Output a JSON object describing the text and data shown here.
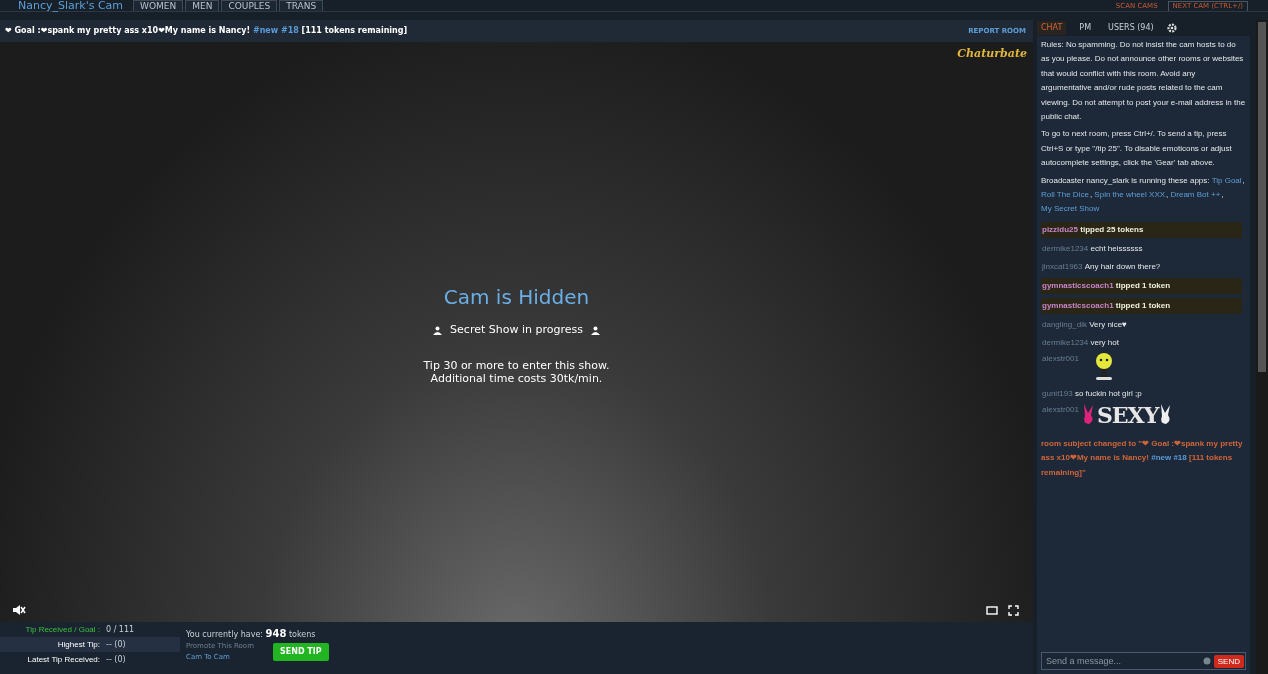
{
  "nav": {
    "title": "Nancy_Slark's Cam",
    "tabs": [
      {
        "label": "WOMEN",
        "selected": false
      },
      {
        "label": "MEN",
        "selected": false
      },
      {
        "label": "COUPLES",
        "selected": false
      },
      {
        "label": "TRANS",
        "selected": false
      }
    ],
    "links": [
      {
        "label": "SCAN CAMS",
        "kind": "plain"
      },
      {
        "label": "NEXT CAM (CTRL+/)",
        "kind": "boxed"
      }
    ]
  },
  "subject": {
    "parts": [
      {
        "kind": "text",
        "text": "❤ Goal :❤spank my pretty ass x10❤My name is Nancy!"
      },
      {
        "kind": "hashtag",
        "text": "#new #18"
      },
      {
        "kind": "text",
        "text": "[111 tokens remaining]"
      }
    ],
    "report": "REPORT ROOM"
  },
  "video": {
    "logo": "Chaturbate",
    "title": "Cam is Hidden",
    "status": "Secret Show in progress",
    "lines": [
      "Tip 30 or more to enter this show.",
      "Additional time costs 30tk/min."
    ],
    "muted": true
  },
  "stats": [
    {
      "label": "Tip Received / Goal :",
      "value": "0 / 111",
      "highlight": true
    },
    {
      "label": "Highest Tip:",
      "value": "-- (0)",
      "highlight": false
    },
    {
      "label": "Latest Tip Received:",
      "value": "-- (0)",
      "highlight": false
    }
  ],
  "tokens": {
    "prefix": "You currently have:",
    "amount": "948",
    "suffix": "tokens",
    "promote": "Promote This Room",
    "link": "Cam To Cam",
    "button": "SEND TIP"
  },
  "chat": {
    "tabs": [
      {
        "label": "CHAT",
        "selected": true
      },
      {
        "label": "PM",
        "selected": false
      },
      {
        "label": "USERS (94)",
        "selected": false
      }
    ],
    "notices": [
      "Rules: No spamming. Do not insist the cam hosts to do as you please. Do not announce other rooms or websites that would conflict with this room. Avoid any argumentative and/or rude posts related to the cam viewing. Do not attempt to post your e-mail address in the public chat.",
      "To go to next room, press Ctrl+/. To send a tip, press Ctrl+S or type \"/tip 25\". To disable emoticons or adjust autocomplete settings, click the 'Gear' tab above."
    ],
    "apps": {
      "text": "Broadcaster nancy_slark is running these apps:",
      "separator": ",",
      "links": [
        "Tip Goal",
        "Roll The Dice",
        "Spin the wheel XXX",
        "Dream Bot ++",
        "My Secret Show"
      ]
    },
    "messages": [
      {
        "kind": "tip",
        "user": "pizzidu25",
        "text": "tipped 25 tokens"
      },
      {
        "kind": "text",
        "user": "dermike1234",
        "text": "echt heissssss"
      },
      {
        "kind": "text",
        "user": "jinxcat1963",
        "text": "Any hair down there?"
      },
      {
        "kind": "tip",
        "user": "gymnasticscoach1",
        "text": "tipped 1 token"
      },
      {
        "kind": "tip",
        "user": "gymnasticscoach1",
        "text": "tipped 1 token"
      },
      {
        "kind": "text",
        "user": "dangling_dik",
        "text": "Very nice♥"
      },
      {
        "kind": "text",
        "user": "dermike1234",
        "text": "very hot"
      },
      {
        "kind": "emoticon",
        "user": "alexstr001"
      },
      {
        "kind": "text",
        "user": "gunit193",
        "text": "so fuckin hot girl ;p"
      },
      {
        "kind": "sticker",
        "user": "alexstr001",
        "text": "SEXY"
      }
    ],
    "subject_change": {
      "prefix": "room subject changed to \"❤ Goal :❤spank my pretty ass x10❤My name is Nancy!",
      "hashtag": "#new #18",
      "suffix": "[111 tokens remaining]\""
    },
    "input": {
      "placeholder": "Send a message...",
      "button": "SEND"
    }
  }
}
